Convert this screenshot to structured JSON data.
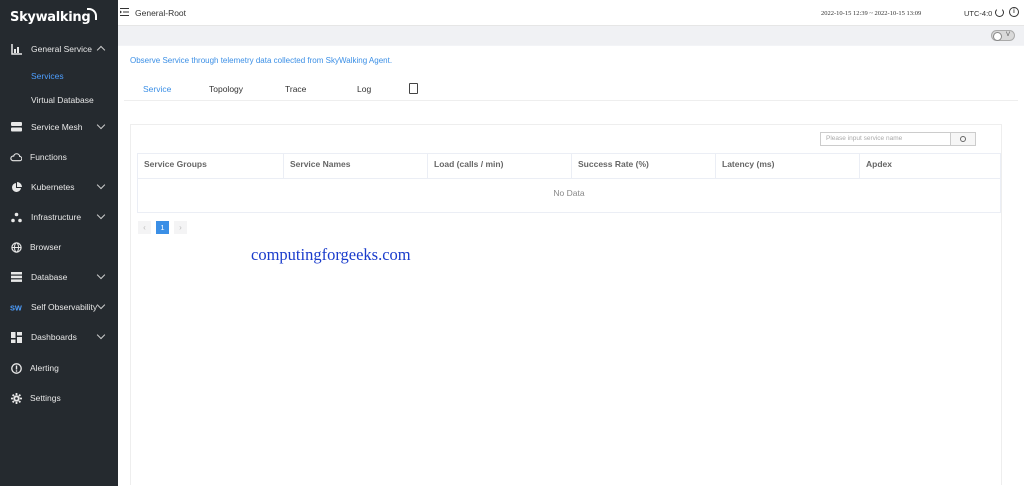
{
  "app": {
    "logo": "Skywalking"
  },
  "sidebar": {
    "items": [
      {
        "label": "General Service",
        "icon": "bar-chart-icon",
        "expanded": true
      },
      {
        "label": "Services",
        "sub": true,
        "active": true
      },
      {
        "label": "Virtual Database",
        "sub": true
      },
      {
        "label": "Service Mesh",
        "icon": "database-icon",
        "expanded": false
      },
      {
        "label": "Functions",
        "icon": "cloud-icon"
      },
      {
        "label": "Kubernetes",
        "icon": "pie-chart-icon",
        "expanded": false
      },
      {
        "label": "Infrastructure",
        "icon": "nodes-icon",
        "expanded": false
      },
      {
        "label": "Browser",
        "icon": "globe-icon"
      },
      {
        "label": "Database",
        "icon": "database-stack-icon",
        "expanded": false
      },
      {
        "label": "Self Observability",
        "icon": "sw-icon",
        "expanded": false
      },
      {
        "label": "Dashboards",
        "icon": "dashboard-grid-icon",
        "expanded": false
      },
      {
        "label": "Alerting",
        "icon": "alert-icon"
      },
      {
        "label": "Settings",
        "icon": "gear-icon"
      }
    ]
  },
  "header": {
    "breadcrumb": "General-Root",
    "time_range": "2022-10-15 12:39 ~ 2022-10-15 13:09",
    "timezone": "UTC-4:0"
  },
  "toolbar": {
    "toggle_label": "V"
  },
  "main": {
    "description": "Observe Service through telemetry data collected from SkyWalking Agent.",
    "tabs": [
      {
        "label": "Service",
        "active": true
      },
      {
        "label": "Topology"
      },
      {
        "label": "Trace"
      },
      {
        "label": "Log"
      }
    ],
    "search_placeholder": "Please input service name",
    "table": {
      "columns": [
        "Service Groups",
        "Service Names",
        "Load (calls / min)",
        "Success Rate (%)",
        "Latency (ms)",
        "Apdex"
      ],
      "empty_text": "No Data"
    },
    "pagination": {
      "prev": "‹",
      "current": "1",
      "next": "›"
    }
  },
  "watermark": "computingforgeeks.com",
  "colors": {
    "sidebar_bg": "#252a2f",
    "accent": "#3b8fe6",
    "watermark": "#1a3ccc"
  }
}
